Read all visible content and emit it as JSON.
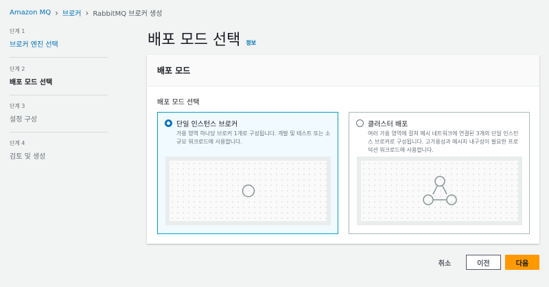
{
  "breadcrumb": [
    "Amazon MQ",
    "브로커",
    "RabbitMQ 브로커 생성"
  ],
  "steps": [
    {
      "n": "단계 1",
      "t": "브로커 엔진 선택"
    },
    {
      "n": "단계 2",
      "t": "배포 모드 선택"
    },
    {
      "n": "단계 3",
      "t": "설정 구성"
    },
    {
      "n": "단계 4",
      "t": "검토 및 생성"
    }
  ],
  "title": "배포 모드 선택",
  "info": "정보",
  "panel": {
    "header": "배포 모드",
    "label": "배포 모드 선택",
    "options": [
      {
        "title": "단일 인스턴스 브로커",
        "desc": "가용 영역 하나당 브로커 1개로 구성됩니다. 개발 및 테스트 또는 소규모 워크로드에 사용합니다.",
        "selected": true
      },
      {
        "title": "클러스터 배포",
        "desc": "여러 가용 영역에 걸쳐 메시 네트워크에 연결된 3개의 단일 인스턴스 브로커로 구성됩니다. 고가용성과 메시지 내구성이 필요한 프로덕션 워크로드에 사용합니다.",
        "selected": false
      }
    ]
  },
  "buttons": {
    "cancel": "취소",
    "prev": "이전",
    "next": "다음"
  },
  "colors": {
    "accent": "#0073bb",
    "primary": "#ff9900"
  }
}
